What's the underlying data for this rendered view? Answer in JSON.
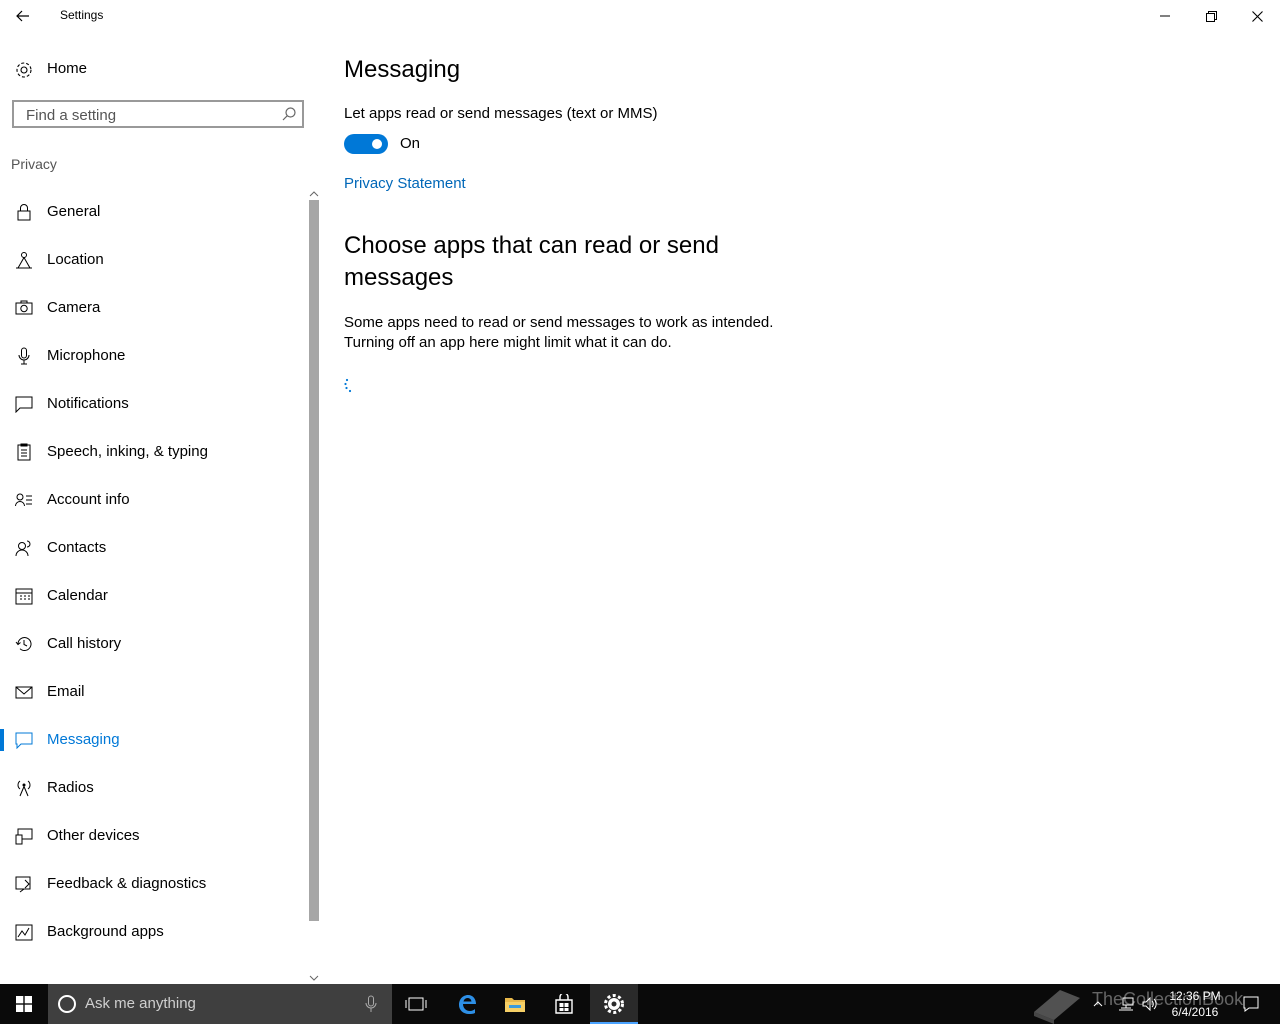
{
  "window": {
    "title": "Settings"
  },
  "sidebar": {
    "home_label": "Home",
    "search_placeholder": "Find a setting",
    "section_label": "Privacy",
    "items": [
      {
        "label": "General",
        "icon": "lock-icon"
      },
      {
        "label": "Location",
        "icon": "location-icon"
      },
      {
        "label": "Camera",
        "icon": "camera-icon"
      },
      {
        "label": "Microphone",
        "icon": "microphone-icon"
      },
      {
        "label": "Notifications",
        "icon": "notification-icon"
      },
      {
        "label": "Speech, inking, & typing",
        "icon": "clipboard-icon"
      },
      {
        "label": "Account info",
        "icon": "account-icon"
      },
      {
        "label": "Contacts",
        "icon": "contacts-icon"
      },
      {
        "label": "Calendar",
        "icon": "calendar-icon"
      },
      {
        "label": "Call history",
        "icon": "history-icon"
      },
      {
        "label": "Email",
        "icon": "mail-icon"
      },
      {
        "label": "Messaging",
        "icon": "message-icon",
        "active": true
      },
      {
        "label": "Radios",
        "icon": "radio-icon"
      },
      {
        "label": "Other devices",
        "icon": "devices-icon"
      },
      {
        "label": "Feedback & diagnostics",
        "icon": "feedback-icon"
      },
      {
        "label": "Background apps",
        "icon": "background-apps-icon"
      }
    ]
  },
  "main": {
    "title": "Messaging",
    "setting_label": "Let apps read or send messages (text or MMS)",
    "toggle_state": "On",
    "privacy_link": "Privacy Statement",
    "section_heading": "Choose apps that can read or send messages",
    "description_line1": "Some apps need to read or send messages to work as intended.",
    "description_line2": "Turning off an app here might limit what it can do."
  },
  "taskbar": {
    "search_placeholder": "Ask me anything",
    "time": "12:36 PM",
    "date": "6/4/2016",
    "watermark": "TheCollectionBook"
  },
  "colors": {
    "accent": "#0078d7",
    "link": "#0067b8",
    "taskbar": "#0a0a0a"
  }
}
